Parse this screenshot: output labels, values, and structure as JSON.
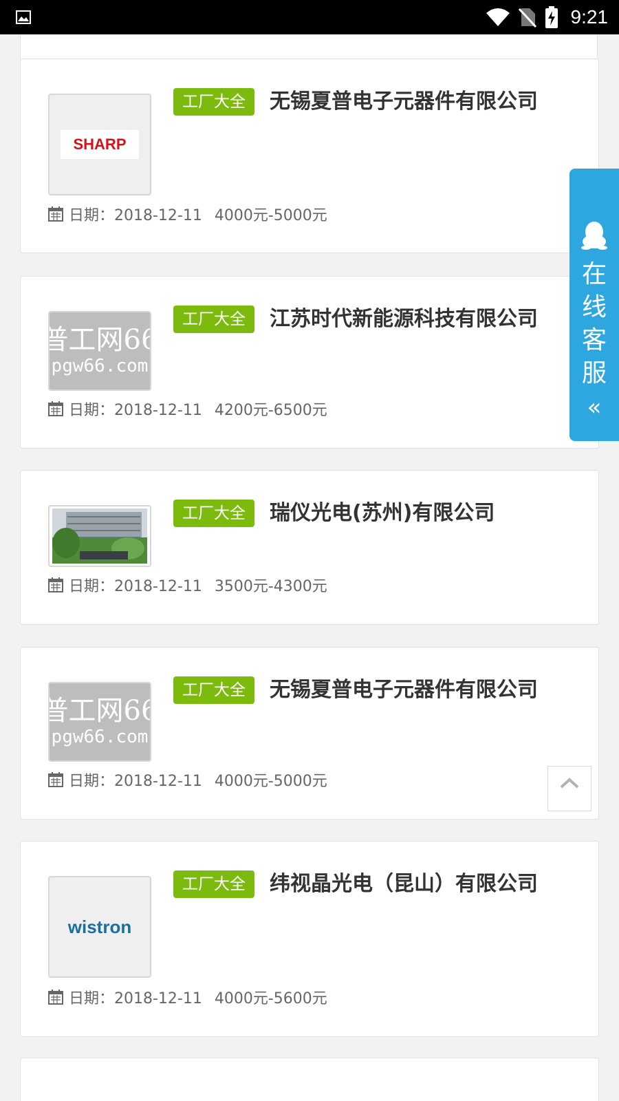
{
  "status_bar": {
    "time": "9:21",
    "icons": [
      "image-icon",
      "wifi-icon",
      "no-sim-icon",
      "battery-charging-icon"
    ]
  },
  "jobs": [
    {
      "tag": "工厂大全",
      "company": "无锡夏普电子元器件有限公司",
      "date": "日期：2018-12-11",
      "salary": "4000元-5000元",
      "logo": "SHARP"
    },
    {
      "tag": "工厂大全",
      "company": "江苏时代新能源科技有限公司",
      "date": "日期：2018-12-11",
      "salary": "4200元-6500元",
      "logo": "普工网66",
      "logo_sub": "pgw66.com"
    },
    {
      "tag": "工厂大全",
      "company": "瑞仪光电(苏州)有限公司",
      "date": "日期：2018-12-11",
      "salary": "3500元-4300元",
      "logo": "factory-photo"
    },
    {
      "tag": "工厂大全",
      "company": "无锡夏普电子元器件有限公司",
      "date": "日期：2018-12-11",
      "salary": "4000元-5000元",
      "logo": "普工网66",
      "logo_sub": "pgw66.com"
    },
    {
      "tag": "工厂大全",
      "company": "纬视晶光电（昆山）有限公司",
      "date": "日期：2018-12-11",
      "salary": "4000元-5600元",
      "logo": "wistron"
    }
  ],
  "online_service": {
    "label": "在线客服",
    "collapse_icon": "double-chevron-left-icon",
    "icon": "qq-icon"
  },
  "back_to_top": {
    "icon": "chevron-up-icon"
  },
  "colors": {
    "tag_green": "#7cbb0e",
    "service_blue": "#2ea7e0",
    "sharp_red": "#d0141c",
    "wistron_blue": "#1a6f9c"
  }
}
